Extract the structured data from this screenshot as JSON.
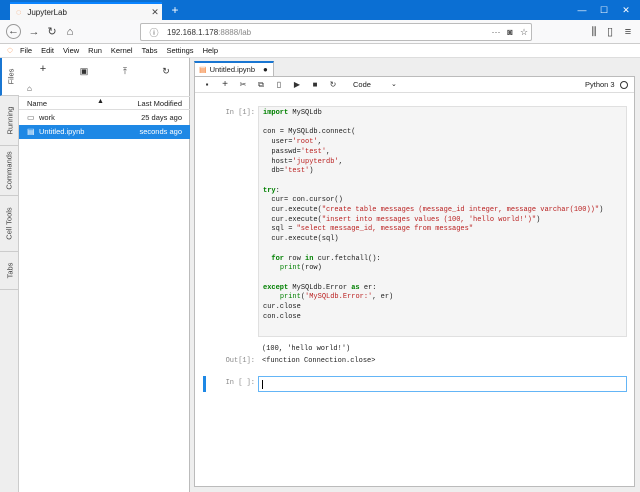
{
  "browser": {
    "tab_title": "JupyterLab",
    "url_host": "192.168.1.178",
    "url_rest": ":8888/lab",
    "new_tab": "+",
    "window_controls": [
      "—",
      "☐",
      "✕"
    ]
  },
  "menubar": [
    "File",
    "Edit",
    "View",
    "Run",
    "Kernel",
    "Tabs",
    "Settings",
    "Help"
  ],
  "left_tabs": [
    "Files",
    "Running",
    "Commands",
    "Cell Tools",
    "Tabs"
  ],
  "filebrowser": {
    "columns": {
      "name": "Name",
      "modified": "Last Modified"
    },
    "files": [
      {
        "name": "work",
        "modified": "25 days ago",
        "icon": "folder-icon",
        "selected": false
      },
      {
        "name": "Untitled.ipynb",
        "modified": "seconds ago",
        "icon": "notebook-icon",
        "selected": true
      }
    ]
  },
  "notebook": {
    "tab_title": "Untitled.ipynb",
    "cell_type": "Code",
    "kernel": "Python 3",
    "cells": [
      {
        "prompt": "In [1]:",
        "out_prompt": "Out[1]:",
        "stdout": "(100, 'hello world!')",
        "result": "<function Connection.close>"
      },
      {
        "prompt": "In [ ]:"
      }
    ]
  },
  "colors": {
    "accent": "#1e88e5",
    "jupyter_orange": "#f37726",
    "browser_title": "#0b6fd3"
  }
}
